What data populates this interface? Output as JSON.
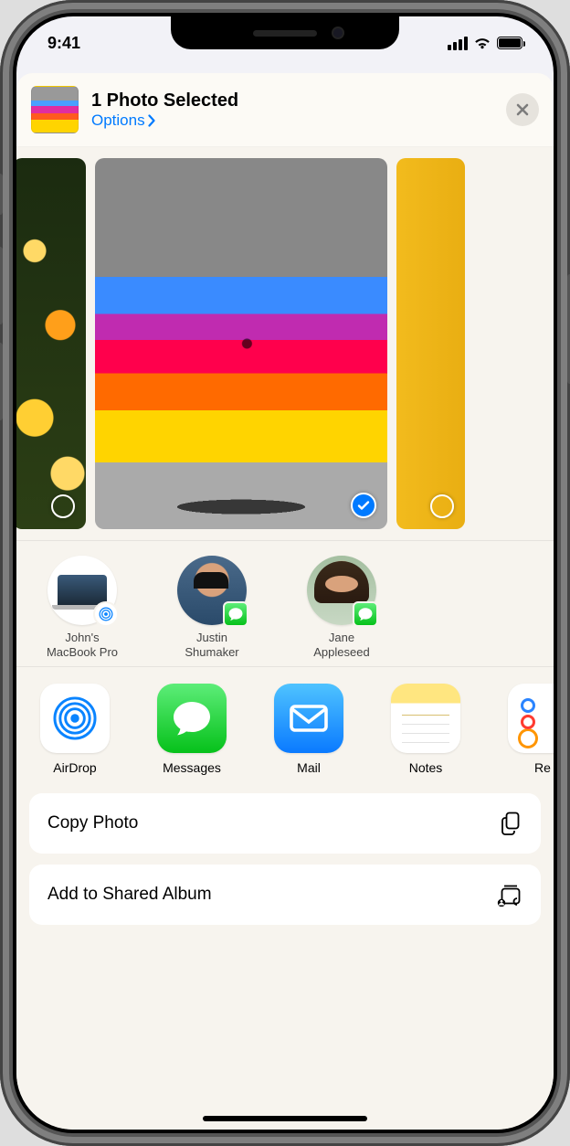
{
  "status": {
    "time": "9:41"
  },
  "header": {
    "title": "1 Photo Selected",
    "options_label": "Options"
  },
  "photos": [
    {
      "id": "flowers",
      "selected": false
    },
    {
      "id": "rainbow",
      "selected": true
    },
    {
      "id": "yellow",
      "selected": false
    }
  ],
  "contacts": [
    {
      "name": "John's\nMacBook Pro",
      "badge": "airdrop",
      "kind": "device"
    },
    {
      "name": "Justin\nShumaker",
      "badge": "messages",
      "kind": "person"
    },
    {
      "name": "Jane\nAppleseed",
      "badge": "messages",
      "kind": "person"
    }
  ],
  "apps": [
    {
      "name": "AirDrop",
      "icon": "airdrop"
    },
    {
      "name": "Messages",
      "icon": "messages"
    },
    {
      "name": "Mail",
      "icon": "mail"
    },
    {
      "name": "Notes",
      "icon": "notes"
    },
    {
      "name": "Re",
      "icon": "reminders"
    }
  ],
  "actions": [
    {
      "label": "Copy Photo",
      "icon": "copy"
    },
    {
      "label": "Add to Shared Album",
      "icon": "shared-album"
    }
  ]
}
